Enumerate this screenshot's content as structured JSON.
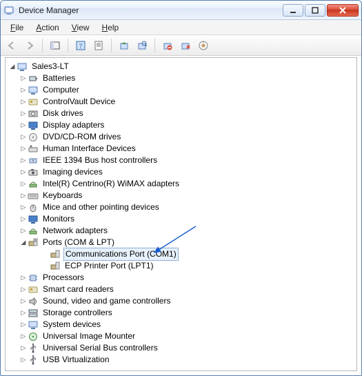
{
  "titlebar": {
    "title": "Device Manager"
  },
  "menu": {
    "file": "File",
    "action": "Action",
    "view": "View",
    "help": "Help"
  },
  "tree": {
    "root": "Sales3-LT",
    "items": [
      "Batteries",
      "Computer",
      "ControlVault Device",
      "Disk drives",
      "Display adapters",
      "DVD/CD-ROM drives",
      "Human Interface Devices",
      "IEEE 1394 Bus host controllers",
      "Imaging devices",
      "Intel(R) Centrino(R) WiMAX adapters",
      "Keyboards",
      "Mice and other pointing devices",
      "Monitors",
      "Network adapters",
      "Ports (COM & LPT)",
      "Processors",
      "Smart card readers",
      "Sound, video and game controllers",
      "Storage controllers",
      "System devices",
      "Universal Image Mounter",
      "Universal Serial Bus controllers",
      "USB Virtualization"
    ],
    "ports_children": [
      "Communications Port (COM1)",
      "ECP Printer Port (LPT1)"
    ],
    "selected": "Communications Port (COM1)"
  }
}
